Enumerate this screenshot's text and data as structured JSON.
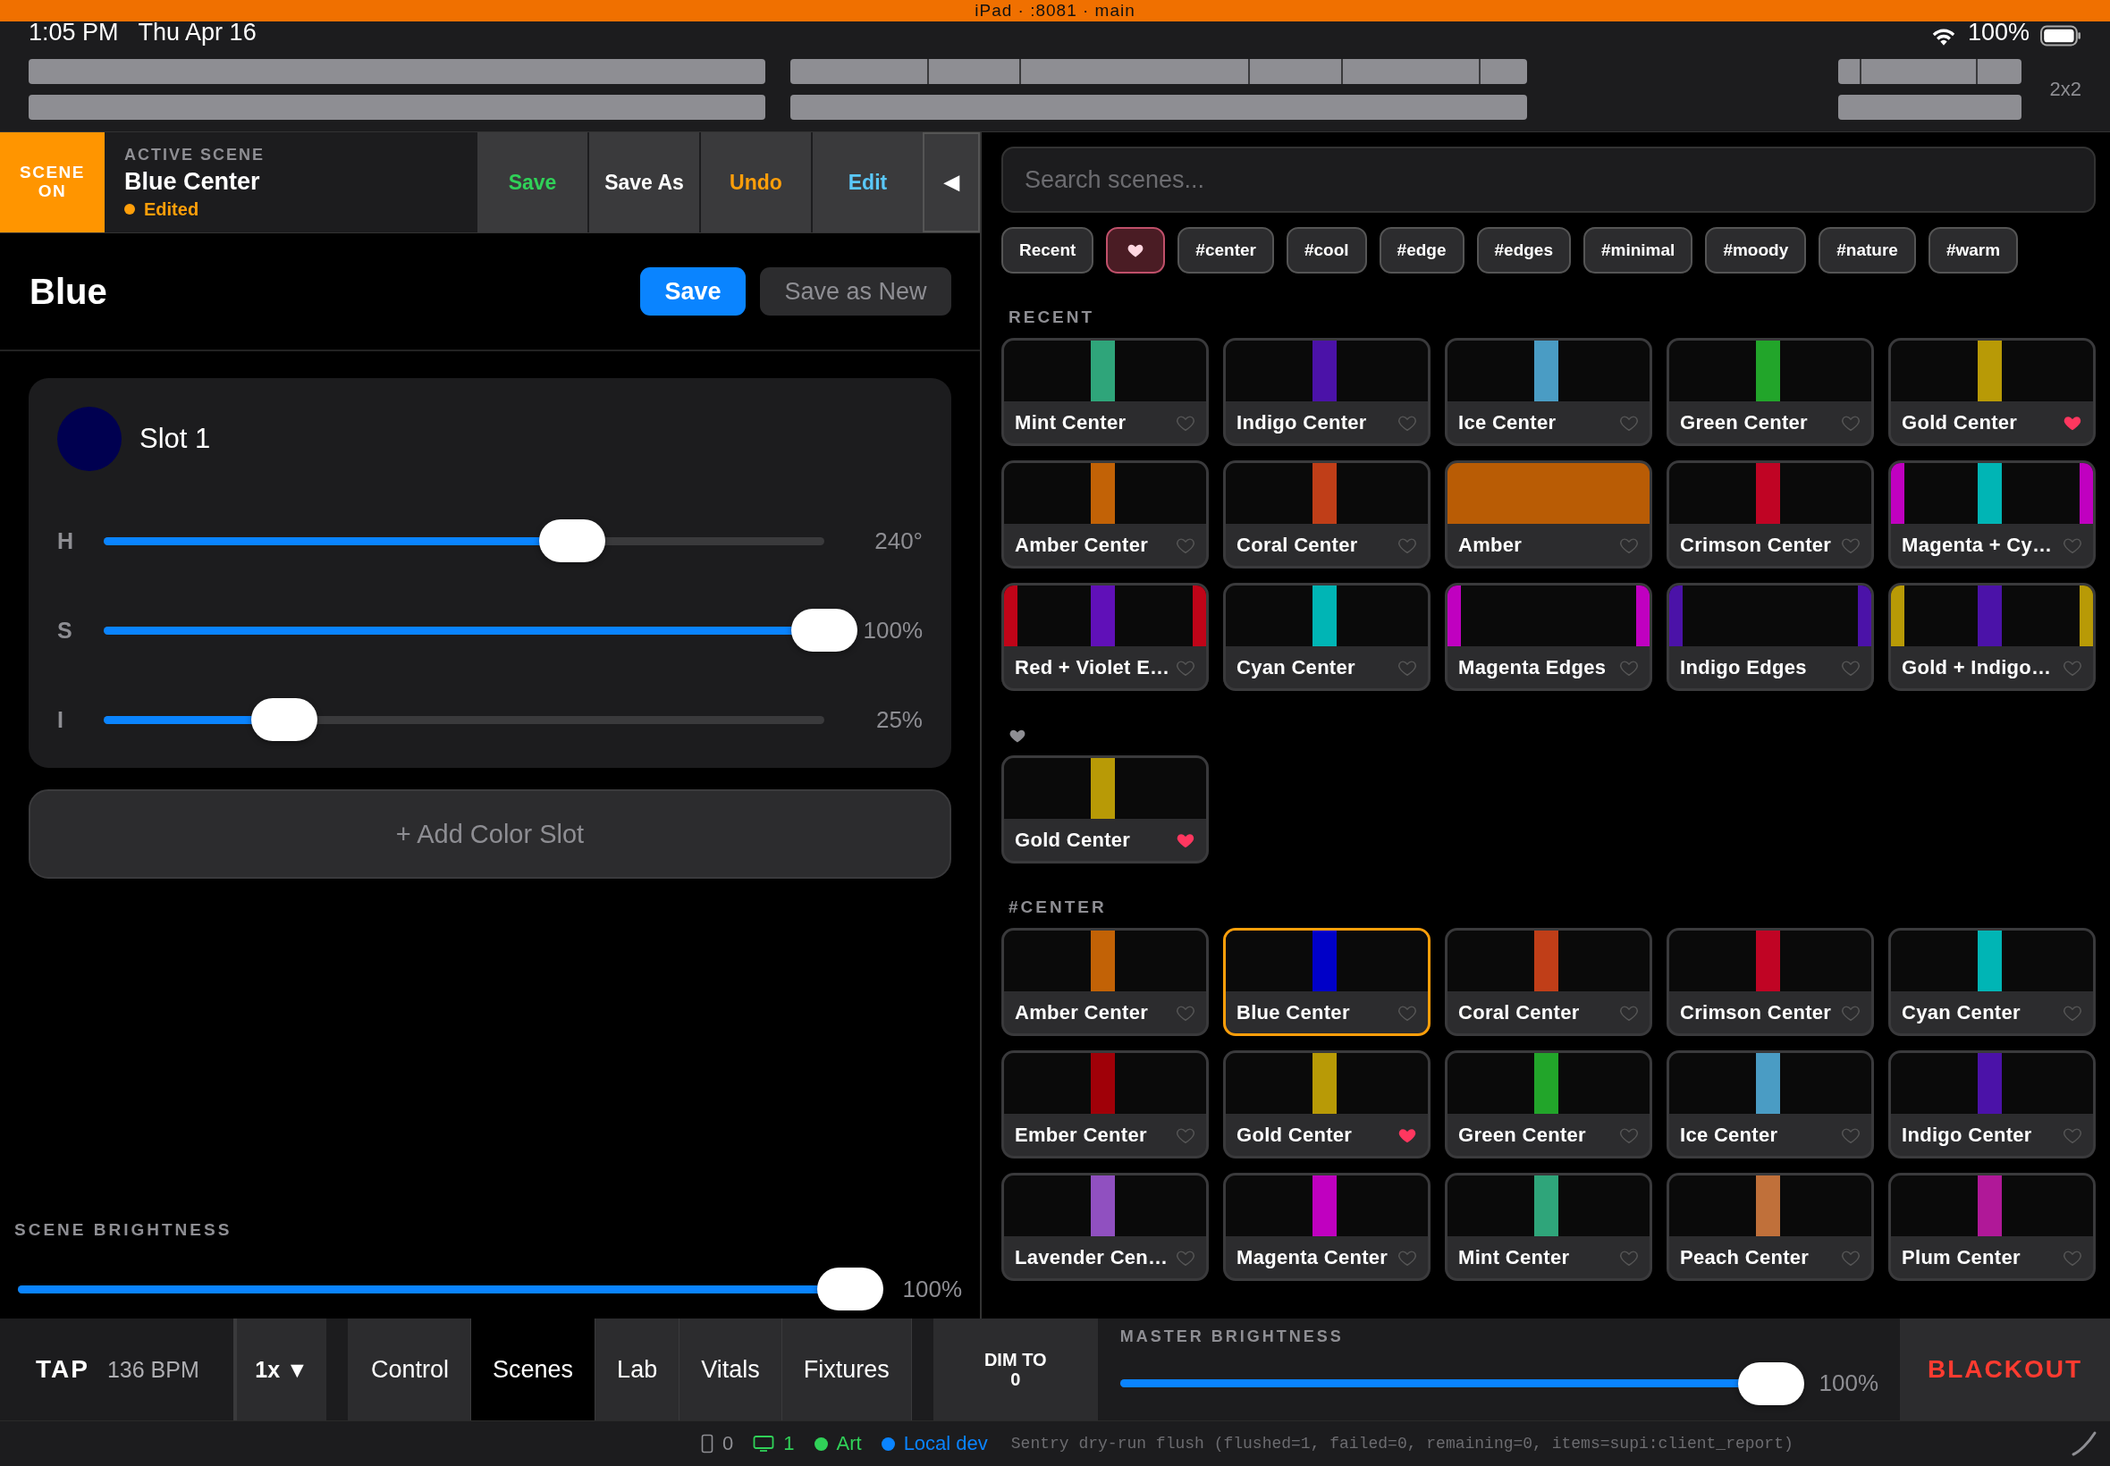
{
  "status_bar": {
    "time": "1:05 PM",
    "date": "Thu Apr 16",
    "title": "iPad · :8081 · main",
    "battery": "100%"
  },
  "layout_label": "2x2",
  "active_scene": {
    "badge": "SCENE ON",
    "caption": "ACTIVE SCENE",
    "name": "Blue Center",
    "status": "Edited",
    "buttons": [
      {
        "kind": "save",
        "label": "Save"
      },
      {
        "kind": "save-as",
        "label": "Save As"
      },
      {
        "kind": "undo",
        "label": "Undo"
      },
      {
        "kind": "edit",
        "label": "Edit"
      },
      {
        "kind": "collapse",
        "label": "◀"
      }
    ]
  },
  "editor": {
    "title": "Blue",
    "save": "Save",
    "save_new": "Save as New",
    "slot": {
      "name": "Slot 1",
      "color": "#000050",
      "sliders": [
        {
          "label": "H",
          "level": 0.65,
          "reading": "240°"
        },
        {
          "label": "S",
          "level": 1.0,
          "reading": "100%"
        },
        {
          "label": "I",
          "level": 0.25,
          "reading": "25%"
        }
      ]
    },
    "add_slot": "+ Add Color Slot",
    "brightness": {
      "label": "SCENE BRIGHTNESS",
      "level": 1.0,
      "reading": "100%"
    }
  },
  "search": {
    "placeholder": "Search scenes..."
  },
  "chips": [
    {
      "kind": "text",
      "label": "Recent",
      "selected": false
    },
    {
      "kind": "favorites",
      "selected": true
    },
    {
      "kind": "text",
      "label": "#center",
      "selected": false
    },
    {
      "kind": "text",
      "label": "#cool",
      "selected": false
    },
    {
      "kind": "text",
      "label": "#edge",
      "selected": false
    },
    {
      "kind": "text",
      "label": "#edges",
      "selected": false
    },
    {
      "kind": "text",
      "label": "#minimal",
      "selected": false
    },
    {
      "kind": "text",
      "label": "#moody",
      "selected": false
    },
    {
      "kind": "text",
      "label": "#nature",
      "selected": false
    },
    {
      "kind": "text",
      "label": "#warm",
      "selected": false
    }
  ],
  "sections": [
    {
      "kind": "label",
      "title": "RECENT",
      "scenes": [
        {
          "name": "Mint Center",
          "stripes": [
            {
              "kind": "center",
              "color": "#2fa57a"
            }
          ],
          "favorite": false,
          "selected": false
        },
        {
          "name": "Indigo Center",
          "stripes": [
            {
              "kind": "center",
              "color": "#4b12a8"
            }
          ],
          "favorite": false,
          "selected": false
        },
        {
          "name": "Ice Center",
          "stripes": [
            {
              "kind": "center",
              "color": "#4a9cc4"
            }
          ],
          "favorite": false,
          "selected": false
        },
        {
          "name": "Green Center",
          "stripes": [
            {
              "kind": "center",
              "color": "#22a52a"
            }
          ],
          "favorite": false,
          "selected": false
        },
        {
          "name": "Gold Center",
          "stripes": [
            {
              "kind": "center",
              "color": "#b89a06"
            }
          ],
          "favorite": true,
          "selected": false
        },
        {
          "name": "Amber Center",
          "stripes": [
            {
              "kind": "center",
              "color": "#c26206"
            }
          ],
          "favorite": false,
          "selected": false
        },
        {
          "name": "Coral Center",
          "stripes": [
            {
              "kind": "center",
              "color": "#c03e18"
            }
          ],
          "favorite": false,
          "selected": false
        },
        {
          "name": "Amber",
          "stripes": [
            {
              "kind": "full",
              "color": "#b95c05"
            }
          ],
          "favorite": false,
          "selected": false
        },
        {
          "name": "Crimson Center",
          "stripes": [
            {
              "kind": "center",
              "color": "#c00424"
            }
          ],
          "favorite": false,
          "selected": false
        },
        {
          "name": "Magenta + Cy…",
          "stripes": [
            {
              "kind": "left",
              "color": "#c000c0"
            },
            {
              "kind": "center",
              "color": "#00b5b5"
            },
            {
              "kind": "right",
              "color": "#c000c0"
            }
          ],
          "favorite": false,
          "selected": false
        },
        {
          "name": "Red + Violet E…",
          "stripes": [
            {
              "kind": "left",
              "color": "#c00418"
            },
            {
              "kind": "center",
              "color": "#6010b8"
            },
            {
              "kind": "right",
              "color": "#c00418"
            }
          ],
          "favorite": false,
          "selected": false
        },
        {
          "name": "Cyan Center",
          "stripes": [
            {
              "kind": "center",
              "color": "#00b5b5"
            }
          ],
          "favorite": false,
          "selected": false
        },
        {
          "name": "Magenta Edges",
          "stripes": [
            {
              "kind": "left",
              "color": "#c000c0"
            },
            {
              "kind": "right",
              "color": "#c000c0"
            }
          ],
          "favorite": false,
          "selected": false
        },
        {
          "name": "Indigo Edges",
          "stripes": [
            {
              "kind": "left",
              "color": "#4b12a8"
            },
            {
              "kind": "right",
              "color": "#4b12a8"
            }
          ],
          "favorite": false,
          "selected": false
        },
        {
          "name": "Gold + Indigo…",
          "stripes": [
            {
              "kind": "left",
              "color": "#b89a06"
            },
            {
              "kind": "center",
              "color": "#4b12a8"
            },
            {
              "kind": "right",
              "color": "#b89a06"
            }
          ],
          "favorite": false,
          "selected": false
        }
      ]
    },
    {
      "kind": "favorites",
      "scenes": [
        {
          "name": "Gold Center",
          "stripes": [
            {
              "kind": "center",
              "color": "#b89a06"
            }
          ],
          "favorite": true,
          "selected": false
        }
      ]
    },
    {
      "kind": "label",
      "title": "#CENTER",
      "scenes": [
        {
          "name": "Amber Center",
          "stripes": [
            {
              "kind": "center",
              "color": "#c26206"
            }
          ],
          "favorite": false,
          "selected": false
        },
        {
          "name": "Blue Center",
          "stripes": [
            {
              "kind": "center",
              "color": "#0000c8"
            }
          ],
          "favorite": false,
          "selected": true
        },
        {
          "name": "Coral Center",
          "stripes": [
            {
              "kind": "center",
              "color": "#c03e18"
            }
          ],
          "favorite": false,
          "selected": false
        },
        {
          "name": "Crimson Center",
          "stripes": [
            {
              "kind": "center",
              "color": "#c00424"
            }
          ],
          "favorite": false,
          "selected": false
        },
        {
          "name": "Cyan Center",
          "stripes": [
            {
              "kind": "center",
              "color": "#00b5b5"
            }
          ],
          "favorite": false,
          "selected": false
        },
        {
          "name": "Ember Center",
          "stripes": [
            {
              "kind": "center",
              "color": "#a00008"
            }
          ],
          "favorite": false,
          "selected": false
        },
        {
          "name": "Gold Center",
          "stripes": [
            {
              "kind": "center",
              "color": "#b89a06"
            }
          ],
          "favorite": true,
          "selected": false
        },
        {
          "name": "Green Center",
          "stripes": [
            {
              "kind": "center",
              "color": "#22a52a"
            }
          ],
          "favorite": false,
          "selected": false
        },
        {
          "name": "Ice Center",
          "stripes": [
            {
              "kind": "center",
              "color": "#4a9cc4"
            }
          ],
          "favorite": false,
          "selected": false
        },
        {
          "name": "Indigo Center",
          "stripes": [
            {
              "kind": "center",
              "color": "#4b12a8"
            }
          ],
          "favorite": false,
          "selected": false
        },
        {
          "name": "Lavender Cen…",
          "stripes": [
            {
              "kind": "center",
              "color": "#9050c0"
            }
          ],
          "favorite": false,
          "selected": false
        },
        {
          "name": "Magenta Center",
          "stripes": [
            {
              "kind": "center",
              "color": "#c000c0"
            }
          ],
          "favorite": false,
          "selected": false
        },
        {
          "name": "Mint Center",
          "stripes": [
            {
              "kind": "center",
              "color": "#2fa57a"
            }
          ],
          "favorite": false,
          "selected": false
        },
        {
          "name": "Peach Center",
          "stripes": [
            {
              "kind": "center",
              "color": "#c0703a"
            }
          ],
          "favorite": false,
          "selected": false
        },
        {
          "name": "Plum Center",
          "stripes": [
            {
              "kind": "center",
              "color": "#b01898"
            }
          ],
          "favorite": false,
          "selected": false
        }
      ]
    }
  ],
  "bottom_bar": {
    "tap": "TAP",
    "bpm": "136 BPM",
    "rate": "1x ▼",
    "tabs": [
      {
        "label": "Control",
        "selected": false
      },
      {
        "label": "Scenes",
        "selected": true
      },
      {
        "label": "Lab",
        "selected": false
      },
      {
        "label": "Vitals",
        "selected": false
      },
      {
        "label": "Fixtures",
        "selected": false
      }
    ],
    "dim": "DIM TO\n0",
    "master": {
      "label": "MASTER BRIGHTNESS",
      "level": 1.0,
      "reading": "100%"
    },
    "blackout": "BLACKOUT"
  },
  "footer": {
    "items": [
      {
        "kind": "phone",
        "text": "0"
      },
      {
        "kind": "screen",
        "text": "1"
      },
      {
        "kind": "dot",
        "text": "Art",
        "color": "#30d158"
      },
      {
        "kind": "dot",
        "text": "Local dev",
        "color": "#0a84ff"
      }
    ],
    "log": "Sentry dry-run flush (flushed=1, failed=0, remaining=0, items=supi:client_report)"
  }
}
